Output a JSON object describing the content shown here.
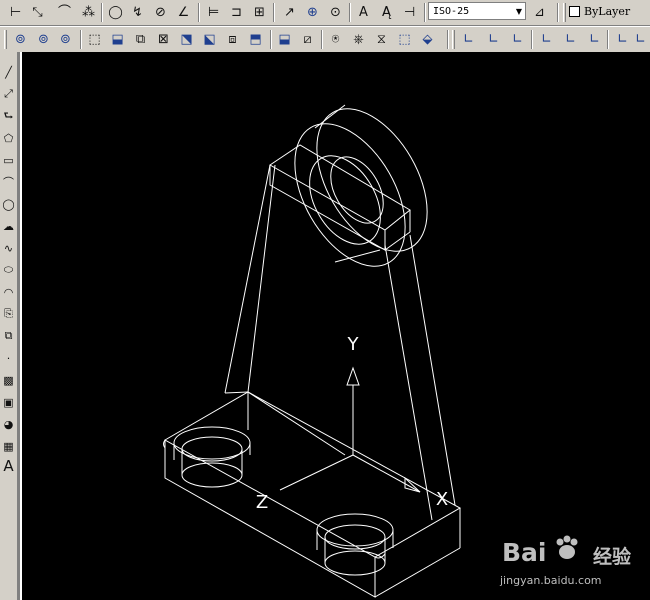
{
  "toolbar": {
    "dimstyle": {
      "value": "ISO-25"
    },
    "layer": {
      "value": "ByLayer"
    }
  },
  "drawing": {
    "ucs_labels": {
      "y": "Y",
      "z": "Z",
      "x": "X"
    },
    "background_color": "#000000",
    "line_color": "#ffffff"
  },
  "watermark": {
    "brand_latin": "Bai",
    "brand_cn": "经验",
    "url": "jingyan.baidu.com"
  },
  "icons": {
    "top_row": [
      "linear-dim-icon",
      "aligned-dim-icon",
      "arc-length-icon",
      "ordinate-dim-icon",
      "radius-dim-icon",
      "jogged-dim-icon",
      "diameter-dim-icon",
      "angular-dim-icon",
      "quick-dim-icon",
      "baseline-dim-icon",
      "continue-dim-icon",
      "leader-icon",
      "tolerance-icon",
      "center-mark-icon",
      "dim-edit-icon",
      "dim-text-edit-icon",
      "dim-update-icon",
      "dimstyle-icon"
    ],
    "second_row": [
      "union-icon",
      "subtract-icon",
      "intersect-icon",
      "solid-edit-icons",
      "ucs-icons"
    ],
    "left_column": [
      "line-icon",
      "construction-line-icon",
      "polyline-icon",
      "polygon-icon",
      "rectangle-icon",
      "arc-icon",
      "circle-icon",
      "revision-cloud-icon",
      "spline-icon",
      "ellipse-icon",
      "ellipse-arc-icon",
      "insert-block-icon",
      "make-block-icon",
      "point-icon",
      "hatch-icon",
      "gradient-icon",
      "region-icon",
      "table-icon",
      "multiline-text-icon"
    ]
  }
}
